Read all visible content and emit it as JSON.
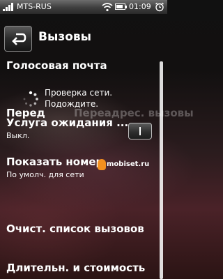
{
  "status": {
    "operator": "MTS-RUS",
    "time": "01:09"
  },
  "header": {
    "title": "Вызовы"
  },
  "menu": {
    "voicemail": "Голосовая почта",
    "forwarding_partial": "Перед",
    "forwarding_ghost": "Переадрес. вызовы",
    "call_waiting": "Услуга ожидания ...",
    "call_waiting_value": "Выкл.",
    "show_number": "Показать номер",
    "show_number_value": "По умолч. для сети",
    "clear_list": "Очист. список вызовов",
    "duration_cost": "Длительн. и стоимость"
  },
  "dialog": {
    "line1": "Проверка сети.",
    "line2": "Подождите."
  },
  "watermark": "mobiset.ru",
  "colors": {
    "accent_logo": "#f3901e",
    "statusbar": "#4a4a4a"
  },
  "icons": {
    "signal": "signal-bars-icon",
    "wifi": "wifi-icon",
    "battery": "battery-icon",
    "alarm": "alarm-clock-icon",
    "back": "back-arrow-icon",
    "spinner": "loading-spinner-icon"
  },
  "toggle": {
    "state": "off"
  }
}
